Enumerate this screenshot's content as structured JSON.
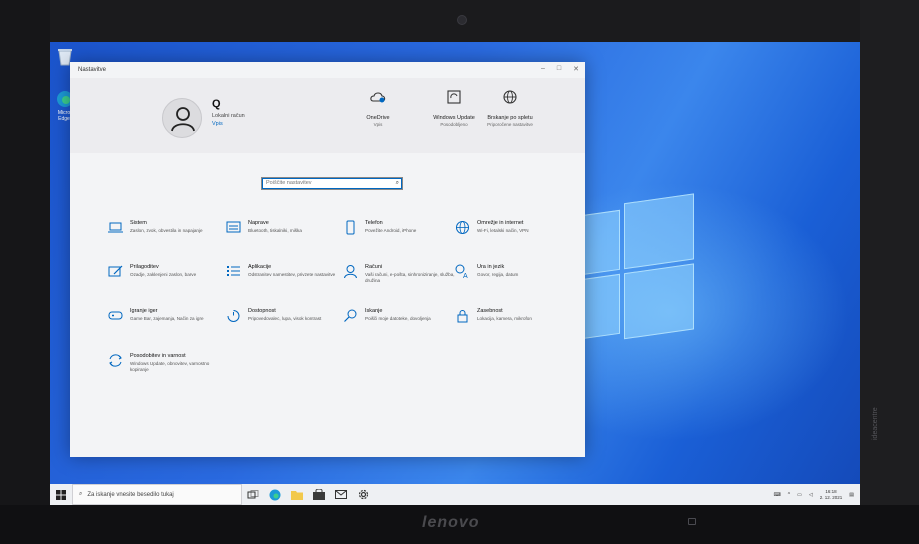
{
  "window": {
    "title": "Nastavitve",
    "ctrl_min": "–",
    "ctrl_max": "□",
    "ctrl_close": "✕"
  },
  "user": {
    "name": "Q",
    "account": "Lokalni račun",
    "signin": "Vpis"
  },
  "quick_links": [
    {
      "title": "OneDrive",
      "sub": "Vpis"
    },
    {
      "title": "Windows Update",
      "sub": "Posodobljeno"
    },
    {
      "title": "Brskanje po spletu",
      "sub": "Priporočene nastavitve"
    }
  ],
  "search": {
    "placeholder": "Poiščite nastavitev"
  },
  "categories": [
    {
      "title": "Sistem",
      "desc": "Zaslon, zvok, obvestila in napajanje"
    },
    {
      "title": "Naprave",
      "desc": "Bluetooth, tiskalniki, miška"
    },
    {
      "title": "Telefon",
      "desc": "Povežite Android, iPhone"
    },
    {
      "title": "Omrežje in internet",
      "desc": "Wi-Fi, letalski način, VPN"
    },
    {
      "title": "Prilagoditev",
      "desc": "Ozadje, zaklenjeni zaslon, barve"
    },
    {
      "title": "Aplikacije",
      "desc": "Odstranitev namestitev, privzete nastavitve"
    },
    {
      "title": "Računi",
      "desc": "Vaši računi, e-pošta, sinhroniziranje, služba, družina"
    },
    {
      "title": "Ura in jezik",
      "desc": "Govor, regija, datum"
    },
    {
      "title": "Igranje iger",
      "desc": "Game Bar, zajemanja, Način za igre"
    },
    {
      "title": "Dostopnost",
      "desc": "Pripovedovalec, lupa, visok kontrast"
    },
    {
      "title": "Iskanje",
      "desc": "Poišči moje datoteke, dovoljenja"
    },
    {
      "title": "Zasebnost",
      "desc": "Lokacija, kamera, mikrofon"
    },
    {
      "title": "Posodobitev in varnost",
      "desc": "Windows Update, obnovitev, varnostno kopiranje"
    }
  ],
  "taskbar": {
    "search_placeholder": "Za iskanje vnesite besedilo tukaj",
    "time": "16:18",
    "date": "2. 12. 2021"
  },
  "desktop": {
    "edge_label": "Micro Edge"
  },
  "bezel": {
    "brand": "lenovo",
    "side_label": "ideacentre"
  },
  "colors": {
    "accent": "#0067c0",
    "desktop": "#1f5fd6"
  }
}
